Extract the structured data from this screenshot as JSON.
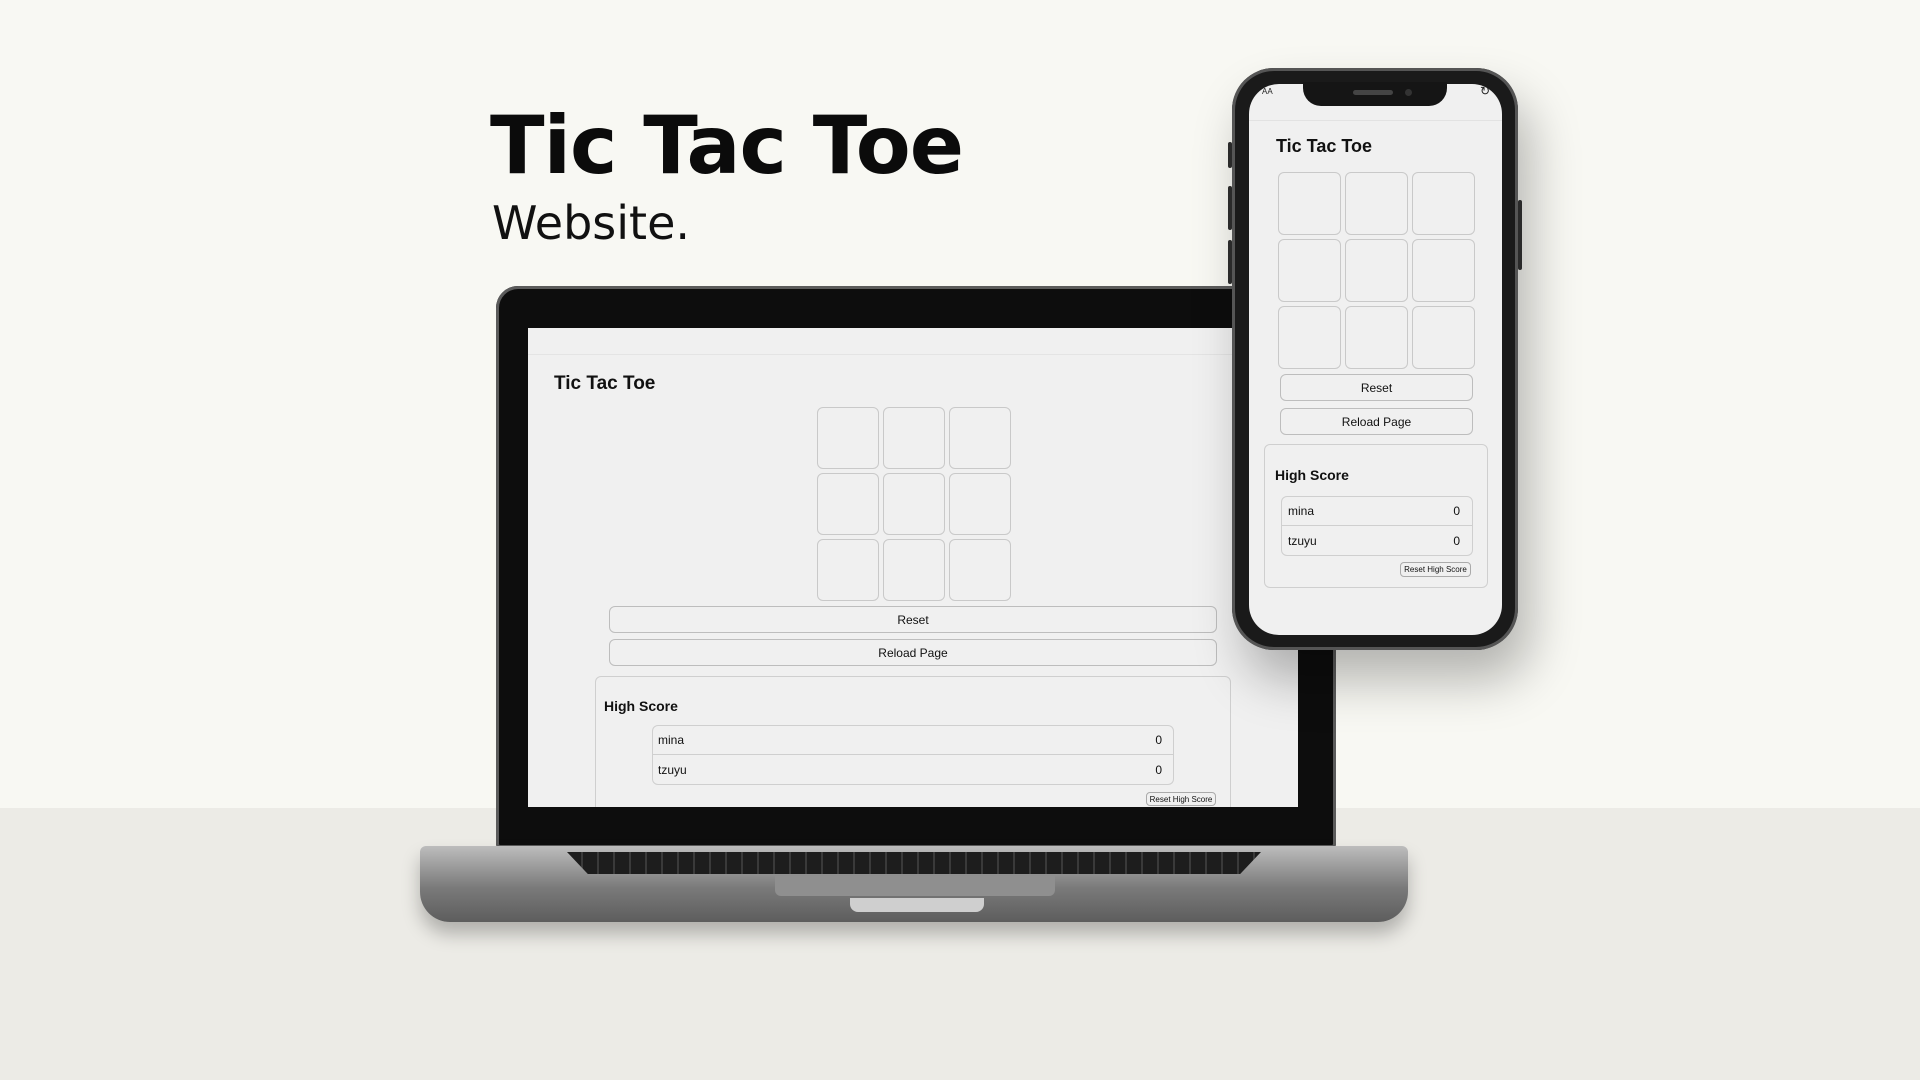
{
  "hero": {
    "title": "Tic Tac Toe",
    "subtitle": "Website."
  },
  "phone_status": {
    "left": "AA",
    "right": "↻"
  },
  "app": {
    "title": "Tic Tac Toe",
    "board": [
      "",
      "",
      "",
      "",
      "",
      "",
      "",
      "",
      ""
    ],
    "reset_label": "Reset",
    "reload_label": "Reload Page",
    "high_score": {
      "heading": "High Score",
      "players": [
        {
          "name": "mina",
          "score": "0"
        },
        {
          "name": "tzuyu",
          "score": "0"
        }
      ],
      "reset_label": "Reset High Score"
    }
  },
  "colors": {
    "page_background": "#f8f8f3",
    "floor": "#ecebe6",
    "app_background": "#f0f0f0",
    "device_body": "#0d0d0d"
  }
}
